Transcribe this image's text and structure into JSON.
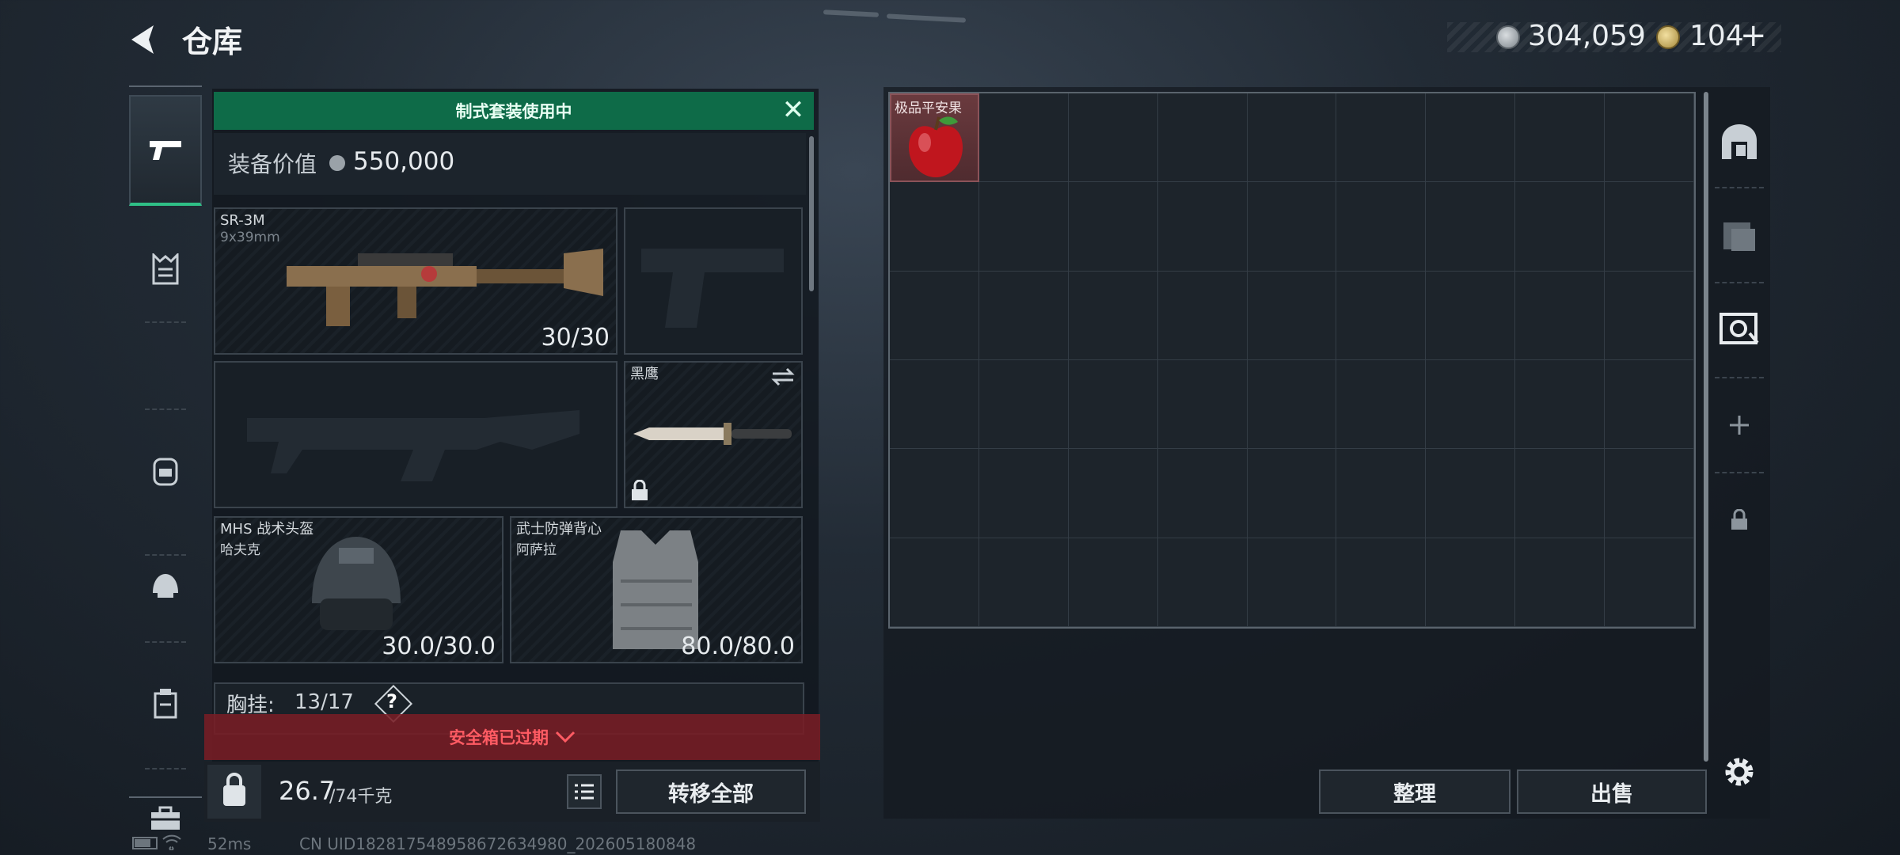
{
  "header": {
    "title": "仓库",
    "currency_1": "304,059",
    "currency_2": "104",
    "plus": "+"
  },
  "left_nav": {
    "items": [
      {
        "name": "weapons",
        "active": true
      },
      {
        "name": "armor-rig"
      },
      {
        "name": "backpack"
      },
      {
        "name": "helmet"
      },
      {
        "name": "medical"
      },
      {
        "name": "toolbox"
      }
    ]
  },
  "loadout": {
    "kit_banner": "制式套装使用中",
    "value_label": "装备价值",
    "value": "550,000",
    "primary_weapon": {
      "name": "SR-3M",
      "caliber": "9x39mm",
      "ammo": "30/30"
    },
    "melee": {
      "name": "黑鹰"
    },
    "helmet": {
      "name": "MHS 战术头盔",
      "sub": "哈夫克",
      "durability": "30.0/30.0"
    },
    "vest": {
      "name": "武士防弹背心",
      "sub": "阿萨拉",
      "durability": "80.0/80.0"
    },
    "chest_rig": {
      "label": "胸挂:",
      "capacity": "13/17",
      "help": "?"
    },
    "safe_box_warning": "安全箱已过期",
    "weight": "26.7",
    "weight_cap": "/74千克",
    "transfer_all": "转移全部"
  },
  "storage": {
    "item_name": "极品平安果",
    "sort": "整理",
    "sell": "出售"
  },
  "status_bar": {
    "ping": "52ms",
    "uid": "CN UID1828175489586726349​80_202605180848"
  },
  "colors": {
    "accent_green": "#0e6b48",
    "warning_red": "#ff5b63"
  }
}
